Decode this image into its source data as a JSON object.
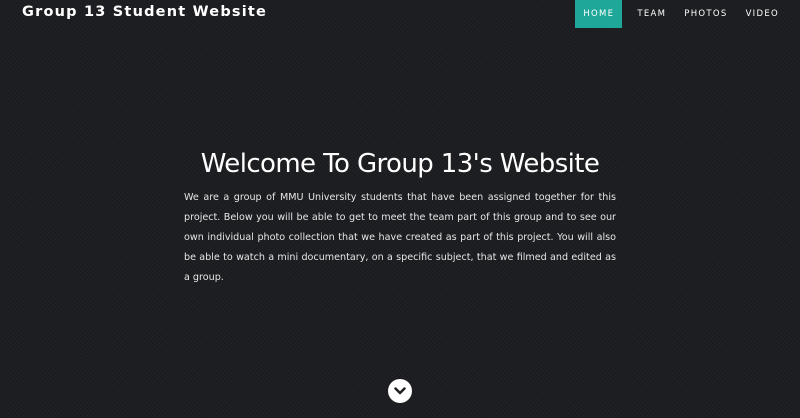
{
  "navbar": {
    "brand": "Group 13 Student Website",
    "items": [
      {
        "label": "HOME",
        "active": true
      },
      {
        "label": "TEAM",
        "active": false
      },
      {
        "label": "PHOTOS",
        "active": false
      },
      {
        "label": "VIDEO",
        "active": false
      }
    ],
    "accent_color": "#1fa89a"
  },
  "hero": {
    "title": "Welcome To Group 13's Website",
    "intro": "We are a group of MMU University students that have been assigned together for this project. Below you will be able to get to meet the team part of this group and to see our own individual photo collection that we have created as part of this project. You will also be able to watch a mini documentary, on a specific subject, that we filmed and edited as a group."
  },
  "scroll_button": {
    "icon": "chevron-down-icon"
  },
  "colors": {
    "background": "#1d1e22",
    "text": "#ffffff"
  }
}
